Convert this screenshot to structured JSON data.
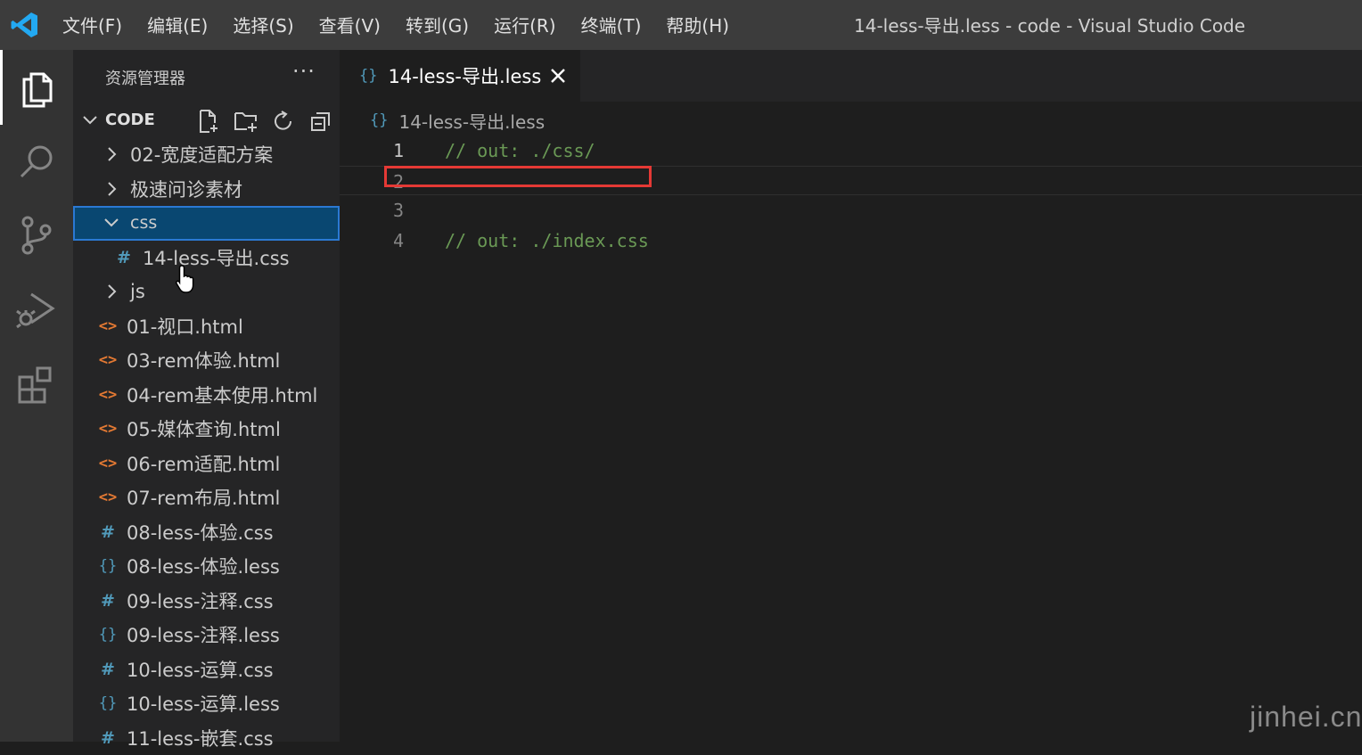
{
  "titlebar": {
    "menu": [
      "文件(F)",
      "编辑(E)",
      "选择(S)",
      "查看(V)",
      "转到(G)",
      "运行(R)",
      "终端(T)",
      "帮助(H)"
    ],
    "window_title": "14-less-导出.less - code - Visual Studio Code"
  },
  "activitybar": {
    "items": [
      "explorer-icon",
      "search-icon",
      "source-control-icon",
      "run-debug-icon",
      "extensions-icon"
    ],
    "active": "explorer-icon"
  },
  "sidebar": {
    "header": "资源管理器",
    "more": "···",
    "section_title": "CODE",
    "tools": [
      "new-file-icon",
      "new-folder-icon",
      "refresh-icon",
      "collapse-all-icon"
    ],
    "tree": [
      {
        "label": "02-宽度适配方案",
        "icon": "chevron-right-icon",
        "kind": "folder"
      },
      {
        "label": "极速问诊素材",
        "icon": "chevron-right-icon",
        "kind": "folder"
      },
      {
        "label": "css",
        "icon": "chevron-down-icon",
        "kind": "folder-open",
        "selected": true
      },
      {
        "label": "14-less-导出.css",
        "icon": "#",
        "kind": "css",
        "nested": true
      },
      {
        "label": "js",
        "icon": "chevron-right-icon",
        "kind": "folder"
      },
      {
        "label": "01-视口.html",
        "icon": "<>",
        "kind": "html"
      },
      {
        "label": "03-rem体验.html",
        "icon": "<>",
        "kind": "html"
      },
      {
        "label": "04-rem基本使用.html",
        "icon": "<>",
        "kind": "html"
      },
      {
        "label": "05-媒体查询.html",
        "icon": "<>",
        "kind": "html"
      },
      {
        "label": "06-rem适配.html",
        "icon": "<>",
        "kind": "html"
      },
      {
        "label": "07-rem布局.html",
        "icon": "<>",
        "kind": "html"
      },
      {
        "label": "08-less-体验.css",
        "icon": "#",
        "kind": "css"
      },
      {
        "label": "08-less-体验.less",
        "icon": "{}",
        "kind": "less"
      },
      {
        "label": "09-less-注释.css",
        "icon": "#",
        "kind": "css"
      },
      {
        "label": "09-less-注释.less",
        "icon": "{}",
        "kind": "less"
      },
      {
        "label": "10-less-运算.css",
        "icon": "#",
        "kind": "css"
      },
      {
        "label": "10-less-运算.less",
        "icon": "{}",
        "kind": "less"
      },
      {
        "label": "11-less-嵌套.css",
        "icon": "#",
        "kind": "css"
      }
    ]
  },
  "editor": {
    "tab_label": "14-less-导出.less",
    "tab_icon": "{}",
    "breadcrumb": "14-less-导出.less",
    "lines": [
      {
        "num": "1",
        "text": "// out: ./css/"
      },
      {
        "num": "2",
        "text": ""
      },
      {
        "num": "3",
        "text": ""
      },
      {
        "num": "4",
        "text": "// out: ./index.css"
      }
    ],
    "current_line": "2"
  },
  "watermark": "jinhei.cn",
  "colors": {
    "titlebar": "#3c3c3c",
    "activitybar": "#333333",
    "sidebar": "#252526",
    "editor": "#1e1e1e",
    "selection": "#094771",
    "comment": "#6a9955",
    "highlight_box": "#e53935",
    "vscode_blue": "#23a9f2"
  }
}
